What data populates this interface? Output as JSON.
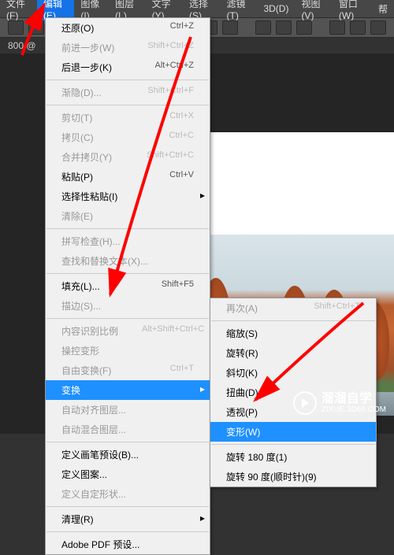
{
  "menubar": {
    "items": [
      {
        "label": "文件(F)"
      },
      {
        "label": "编辑(E)"
      },
      {
        "label": "图像(I)"
      },
      {
        "label": "图层(L)"
      },
      {
        "label": "文字(Y)"
      },
      {
        "label": "选择(S)"
      },
      {
        "label": "滤镜(T)"
      },
      {
        "label": "3D(D)"
      },
      {
        "label": "视图(V)"
      },
      {
        "label": "窗口(W)"
      },
      {
        "label": "帮"
      }
    ],
    "active_index": 1
  },
  "tabinfo": "800 @",
  "edit_menu": [
    {
      "label": "还原(O)",
      "shortcut": "Ctrl+Z"
    },
    {
      "label": "前进一步(W)",
      "shortcut": "Shift+Ctrl+Z",
      "disabled": true
    },
    {
      "label": "后退一步(K)",
      "shortcut": "Alt+Ctrl+Z"
    },
    {
      "sep": true
    },
    {
      "label": "渐隐(D)...",
      "shortcut": "Shift+Ctrl+F",
      "disabled": true
    },
    {
      "sep": true
    },
    {
      "label": "剪切(T)",
      "shortcut": "Ctrl+X",
      "disabled": true
    },
    {
      "label": "拷贝(C)",
      "shortcut": "Ctrl+C",
      "disabled": true
    },
    {
      "label": "合并拷贝(Y)",
      "shortcut": "Shift+Ctrl+C",
      "disabled": true
    },
    {
      "label": "粘贴(P)",
      "shortcut": "Ctrl+V"
    },
    {
      "label": "选择性粘贴(I)",
      "submenu": true
    },
    {
      "label": "清除(E)",
      "disabled": true
    },
    {
      "sep": true
    },
    {
      "label": "拼写检查(H)...",
      "disabled": true
    },
    {
      "label": "查找和替换文本(X)...",
      "disabled": true
    },
    {
      "sep": true
    },
    {
      "label": "填充(L)...",
      "shortcut": "Shift+F5"
    },
    {
      "label": "描边(S)...",
      "disabled": true
    },
    {
      "sep": true
    },
    {
      "label": "内容识别比例",
      "shortcut": "Alt+Shift+Ctrl+C",
      "disabled": true
    },
    {
      "label": "操控变形",
      "disabled": true
    },
    {
      "label": "自由变换(F)",
      "shortcut": "Ctrl+T",
      "disabled": true
    },
    {
      "label": "变换",
      "submenu": true,
      "hl": true
    },
    {
      "label": "自动对齐图层...",
      "disabled": true
    },
    {
      "label": "自动混合图层...",
      "disabled": true
    },
    {
      "sep": true
    },
    {
      "label": "定义画笔预设(B)..."
    },
    {
      "label": "定义图案..."
    },
    {
      "label": "定义自定形状...",
      "disabled": true
    },
    {
      "sep": true
    },
    {
      "label": "清理(R)",
      "submenu": true
    },
    {
      "sep": true
    },
    {
      "label": "Adobe PDF 预设..."
    }
  ],
  "transform_submenu": [
    {
      "label": "再次(A)",
      "shortcut": "Shift+Ctrl+T",
      "disabled": true
    },
    {
      "sep": true
    },
    {
      "label": "缩放(S)"
    },
    {
      "label": "旋转(R)"
    },
    {
      "label": "斜切(K)"
    },
    {
      "label": "扭曲(D)"
    },
    {
      "label": "透视(P)"
    },
    {
      "label": "变形(W)",
      "hl": true
    },
    {
      "sep": true
    },
    {
      "label": "旋转 180 度(1)"
    },
    {
      "label": "旋转 90 度(顺时针)(9)"
    }
  ],
  "watermark": {
    "name": "溜溜自学",
    "site": "ZIXUE.3D66.COM"
  }
}
